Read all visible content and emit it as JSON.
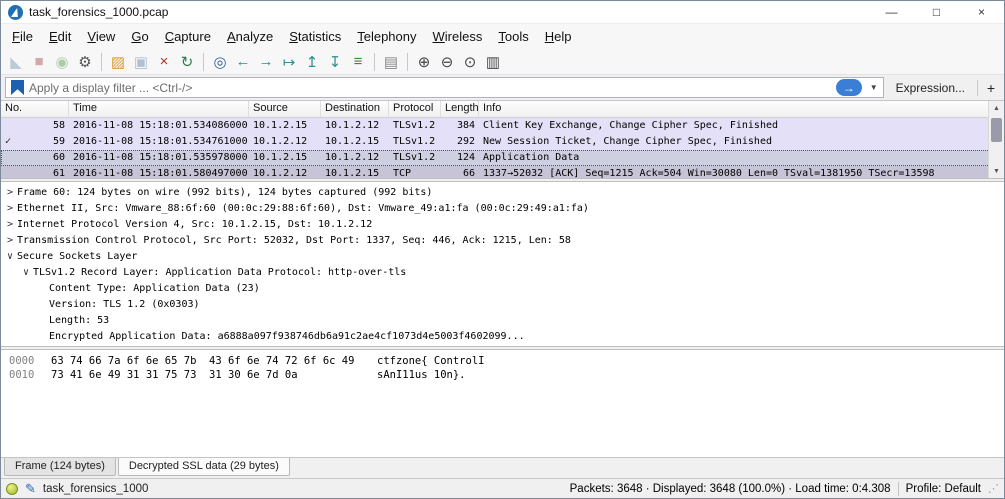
{
  "window": {
    "title": "task_forensics_1000.pcap",
    "controls": [
      {
        "name": "minimize",
        "glyph": "—"
      },
      {
        "name": "maximize",
        "glyph": "□"
      },
      {
        "name": "close",
        "glyph": "×"
      }
    ]
  },
  "menu": {
    "items": [
      "File",
      "Edit",
      "View",
      "Go",
      "Capture",
      "Analyze",
      "Statistics",
      "Telephony",
      "Wireless",
      "Tools",
      "Help"
    ]
  },
  "toolbar": {
    "icons": [
      {
        "name": "start-capture-icon",
        "glyph": "◣",
        "color": "#6b86a8",
        "disabled": true
      },
      {
        "name": "stop-capture-icon",
        "glyph": "■",
        "color": "#a03333",
        "disabled": true
      },
      {
        "name": "restart-capture-icon",
        "glyph": "◉",
        "color": "#3c8c3c",
        "disabled": true
      },
      {
        "name": "capture-options-icon",
        "glyph": "⚙",
        "color": "#555555"
      },
      {
        "sep": true
      },
      {
        "name": "open-file-icon",
        "glyph": "▨",
        "color": "#d79b2f"
      },
      {
        "name": "save-file-icon",
        "glyph": "▣",
        "color": "#4a6f9e",
        "disabled": true
      },
      {
        "name": "close-file-icon",
        "glyph": "×",
        "color": "#b03030"
      },
      {
        "name": "reload-file-icon",
        "glyph": "↻",
        "color": "#2f7d4f"
      },
      {
        "sep": true
      },
      {
        "name": "find-packet-icon",
        "glyph": "◎",
        "color": "#2f5f9e"
      },
      {
        "name": "go-back-icon",
        "glyph": "←",
        "color": "#2a8f8f"
      },
      {
        "name": "go-forward-icon",
        "glyph": "→",
        "color": "#2a8f8f"
      },
      {
        "name": "go-to-packet-icon",
        "glyph": "↦",
        "color": "#2a8f8f"
      },
      {
        "name": "first-packet-icon",
        "glyph": "↥",
        "color": "#2a8f8f"
      },
      {
        "name": "last-packet-icon",
        "glyph": "↧",
        "color": "#2a8f8f"
      },
      {
        "name": "auto-scroll-icon",
        "glyph": "≡",
        "color": "#3c8c3c"
      },
      {
        "sep": true
      },
      {
        "name": "colorize-icon",
        "glyph": "▤",
        "color": "#888888"
      },
      {
        "sep": true
      },
      {
        "name": "zoom-in-icon",
        "glyph": "⊕",
        "color": "#444444"
      },
      {
        "name": "zoom-out-icon",
        "glyph": "⊖",
        "color": "#444444"
      },
      {
        "name": "zoom-reset-icon",
        "glyph": "⊙",
        "color": "#444444"
      },
      {
        "name": "resize-columns-icon",
        "glyph": "▥",
        "color": "#444444"
      }
    ]
  },
  "filter": {
    "placeholder": "Apply a display filter ... <Ctrl-/>",
    "apply_glyph": "→",
    "caret_glyph": "▼",
    "expression_label": "Expression...",
    "add_label": "+"
  },
  "scrollbar": {
    "up_glyph": "▲",
    "down_glyph": "▼"
  },
  "packet_list": {
    "columns": [
      "No.",
      "Time",
      "Source",
      "Destination",
      "Protocol",
      "Length",
      "Info"
    ],
    "rows": [
      {
        "no": "58",
        "time": "2016-11-08 15:18:01.534086000",
        "source": "10.1.2.15",
        "destination": "10.1.2.12",
        "protocol": "TLSv1.2",
        "length": "384",
        "info": "Client Key Exchange, Change Cipher Spec, Finished",
        "marker": "",
        "variant": "tls"
      },
      {
        "no": "59",
        "time": "2016-11-08 15:18:01.534761000",
        "source": "10.1.2.12",
        "destination": "10.1.2.15",
        "protocol": "TLSv1.2",
        "length": "292",
        "info": "New Session Ticket, Change Cipher Spec, Finished",
        "marker": "✓",
        "variant": "tls"
      },
      {
        "no": "60",
        "time": "2016-11-08 15:18:01.535978000",
        "source": "10.1.2.15",
        "destination": "10.1.2.12",
        "protocol": "TLSv1.2",
        "length": "124",
        "info": "Application Data",
        "marker": "",
        "variant": "tls-selected"
      },
      {
        "no": "61",
        "time": "2016-11-08 15:18:01.580497000",
        "source": "10.1.2.12",
        "destination": "10.1.2.15",
        "protocol": "TCP",
        "length": "66",
        "info": "1337→52032 [ACK] Seq=1215 Ack=504 Win=30080 Len=0 TSval=1381950 TSecr=13598",
        "marker": "",
        "variant": "tcp-cut"
      }
    ]
  },
  "details": {
    "lines": [
      {
        "expander": ">",
        "indent": 0,
        "text": "Frame 60: 124 bytes on wire (992 bits), 124 bytes captured (992 bits)"
      },
      {
        "expander": ">",
        "indent": 0,
        "text": "Ethernet II, Src: Vmware_88:6f:60 (00:0c:29:88:6f:60), Dst: Vmware_49:a1:fa (00:0c:29:49:a1:fa)"
      },
      {
        "expander": ">",
        "indent": 0,
        "text": "Internet Protocol Version 4, Src: 10.1.2.15, Dst: 10.1.2.12"
      },
      {
        "expander": ">",
        "indent": 0,
        "text": "Transmission Control Protocol, Src Port: 52032, Dst Port: 1337, Seq: 446, Ack: 1215, Len: 58"
      },
      {
        "expander": "v",
        "indent": 0,
        "text": "Secure Sockets Layer"
      },
      {
        "expander": "v",
        "indent": 1,
        "text": "TLSv1.2 Record Layer: Application Data Protocol: http-over-tls"
      },
      {
        "expander": "",
        "indent": 2,
        "text": "Content Type: Application Data (23)"
      },
      {
        "expander": "",
        "indent": 2,
        "text": "Version: TLS 1.2 (0x0303)"
      },
      {
        "expander": "",
        "indent": 2,
        "text": "Length: 53"
      },
      {
        "expander": "",
        "indent": 2,
        "text": "Encrypted Application Data: a6888a097f938746db6a91c2ae4cf1073d4e5003f4602099..."
      }
    ]
  },
  "hex": {
    "lines": [
      {
        "offset": "0000",
        "bytes": "63 74 66 7a 6f 6e 65 7b  43 6f 6e 74 72 6f 6c 49",
        "ascii": "ctfzone{ ControlI"
      },
      {
        "offset": "0010",
        "bytes": "73 41 6e 49 31 31 75 73  31 30 6e 7d 0a",
        "ascii": "sAnI11us 10n}."
      }
    ]
  },
  "byte_tabs": [
    {
      "label": "Frame (124 bytes)",
      "active": false
    },
    {
      "label": "Decrypted SSL data (29 bytes)",
      "active": true
    }
  ],
  "status": {
    "filename": "task_forensics_1000",
    "stats": "Packets: 3648 · Displayed: 3648 (100.0%) · Load time: 0:4.308",
    "profile": "Profile: Default"
  }
}
